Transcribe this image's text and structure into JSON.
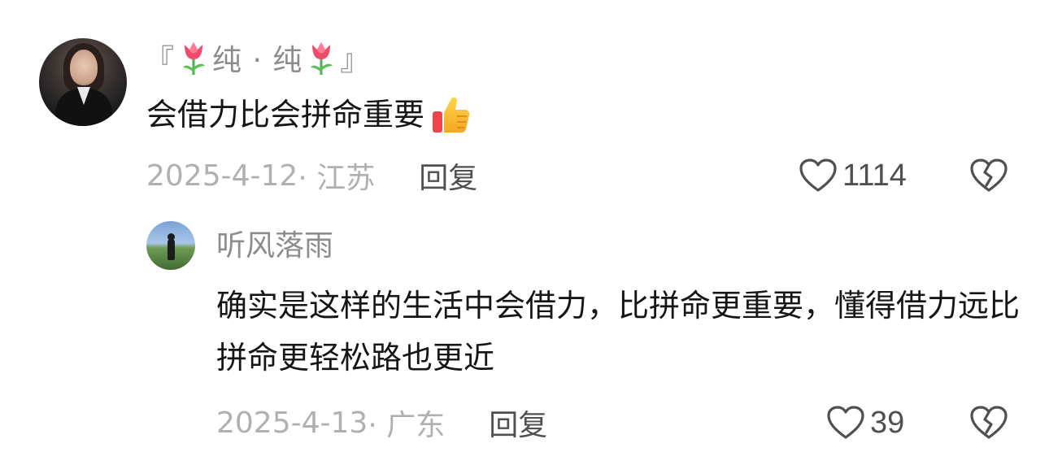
{
  "main_comment": {
    "username_prefix": "『",
    "username_name": "纯 · 纯",
    "username_suffix": "』",
    "username_emoji": "tulip-emoji",
    "text": "会借力比会拼命重要",
    "text_emoji": "thumbs-up-emoji",
    "date": "2025-4-12",
    "location": "· 江苏",
    "reply_label": "回复",
    "like_count": "1114"
  },
  "reply_comment": {
    "username": "听风落雨",
    "text": "确实是这样的生活中会借力，比拼命更重要，懂得借力远比拼命更轻松路也更近",
    "date": "2025-4-13",
    "location": "· 广东",
    "reply_label": "回复",
    "like_count": "39"
  },
  "colors": {
    "secondary_text": "#8c8c8c",
    "meta_text": "#b0b0b0",
    "action_text": "#505050",
    "primary_text": "#161616"
  }
}
